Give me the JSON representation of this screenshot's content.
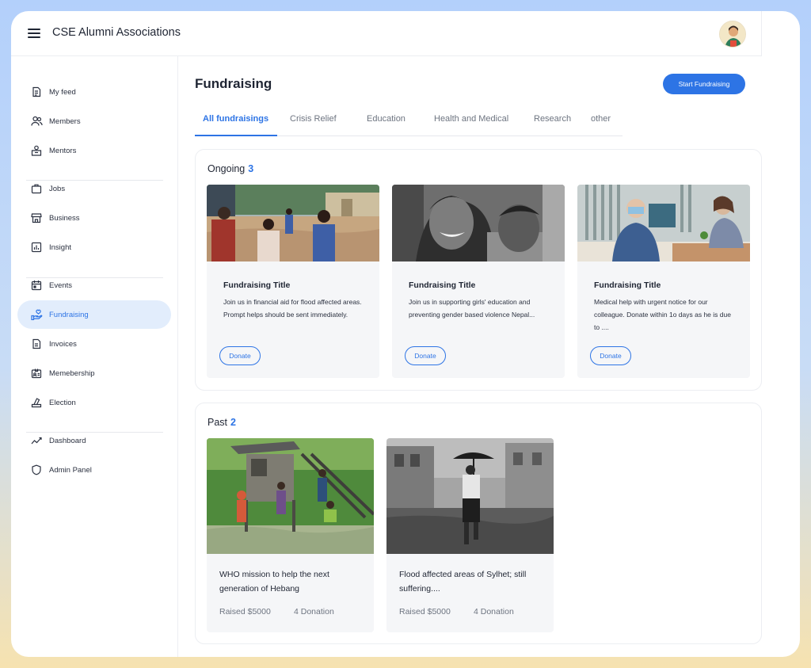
{
  "header": {
    "app_title": "CSE Alumni Associations",
    "menu_icon": "hamburger-menu-icon",
    "avatar_icon": "user-avatar"
  },
  "sidebar": {
    "items": [
      {
        "label": "My feed",
        "icon": "document-icon"
      },
      {
        "label": "Members",
        "icon": "users-icon"
      },
      {
        "label": "Mentors",
        "icon": "mentor-icon"
      },
      {
        "label": "Jobs",
        "icon": "briefcase-icon"
      },
      {
        "label": "Business",
        "icon": "store-icon"
      },
      {
        "label": "Insight",
        "icon": "chart-icon"
      },
      {
        "label": "Events",
        "icon": "calendar-icon"
      },
      {
        "label": "Fundraising",
        "icon": "hand-heart-icon",
        "active": true
      },
      {
        "label": "Invoices",
        "icon": "invoice-icon"
      },
      {
        "label": "Memebership",
        "icon": "id-card-icon"
      },
      {
        "label": "Election",
        "icon": "ballot-icon"
      },
      {
        "label": "Dashboard",
        "icon": "trend-icon"
      },
      {
        "label": "Admin Panel",
        "icon": "shield-icon"
      }
    ]
  },
  "main": {
    "title": "Fundraising",
    "start_button": "Start Fundraising",
    "tabs": [
      {
        "label": "All fundraisings",
        "active": true
      },
      {
        "label": "Crisis Relief"
      },
      {
        "label": "Education"
      },
      {
        "label": "Health and Medical"
      },
      {
        "label": "Research"
      },
      {
        "label": "other"
      }
    ],
    "ongoing": {
      "title": "Ongoing",
      "count": "3",
      "cards": [
        {
          "title": "Fundraising Title",
          "description": "Join us in financial aid for flood affected areas. Prompt helps should be sent immediately.",
          "button": "Donate"
        },
        {
          "title": "Fundraising Title",
          "description": "Join us in supporting girls' education and preventing gender based violence Nepal...",
          "button": "Donate"
        },
        {
          "title": "Fundraising Title",
          "description": "Medical help with urgent notice for our colleague. Donate within 1o days as he is due to ....",
          "button": "Donate"
        }
      ]
    },
    "past": {
      "title": "Past",
      "count": "2",
      "cards": [
        {
          "title": "WHO mission to help the next generation of Hebang",
          "raised": "Raised $5000",
          "donations": "4 Donation"
        },
        {
          "title": "Flood affected areas of Sylhet; still suffering....",
          "raised": "Raised $5000",
          "donations": "4 Donation"
        }
      ]
    }
  },
  "colors": {
    "accent": "#2d74e5",
    "active_bg": "#e2edfc",
    "card_bg": "#f5f6f8"
  }
}
